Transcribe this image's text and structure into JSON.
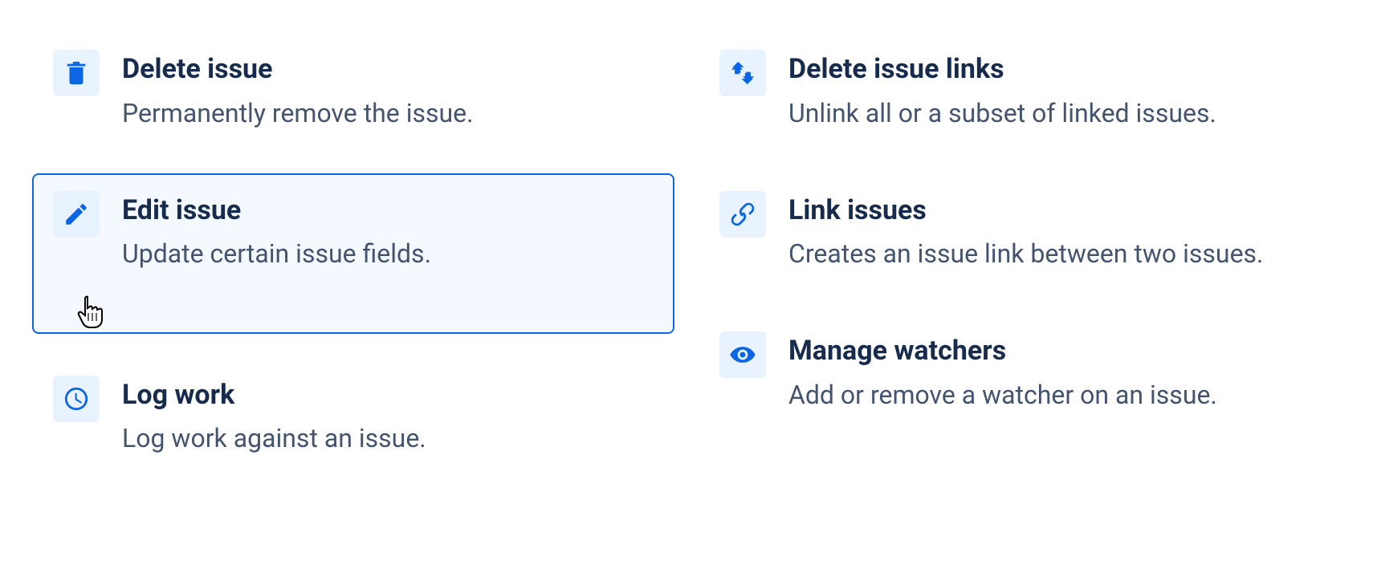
{
  "actions": {
    "deleteIssue": {
      "title": "Delete issue",
      "description": "Permanently remove the issue."
    },
    "editIssue": {
      "title": "Edit issue",
      "description": "Update certain issue fields."
    },
    "logWork": {
      "title": "Log work",
      "description": "Log work against an issue."
    },
    "deleteIssueLinks": {
      "title": "Delete issue links",
      "description": "Unlink all or a subset of linked issues."
    },
    "linkIssues": {
      "title": "Link issues",
      "description": "Creates an issue link between two issues."
    },
    "manageWatchers": {
      "title": "Manage watchers",
      "description": "Add or remove a watcher on an issue."
    }
  }
}
